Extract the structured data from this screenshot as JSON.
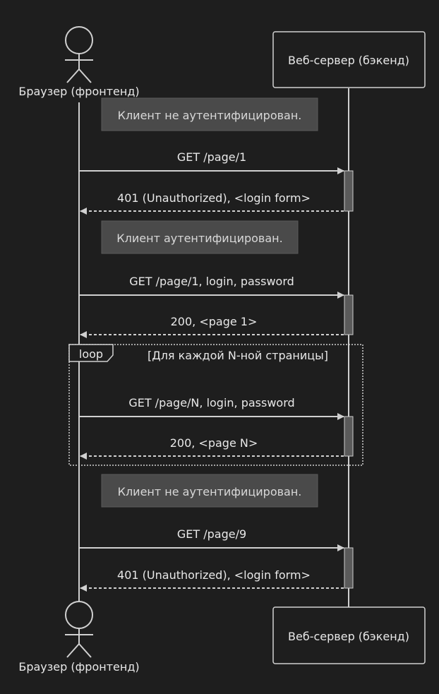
{
  "participants": {
    "browser": {
      "label": "Браузер (фронтенд)"
    },
    "server": {
      "label": "Веб-сервер (бэкенд)"
    }
  },
  "notes": [
    "Клиент не аутентифицирован.",
    "Клиент аутентифицирован.",
    "Клиент не аутентифицирован."
  ],
  "messages": [
    {
      "text": "GET /page/1",
      "dir": "request"
    },
    {
      "text": "401 (Unauthorized), <login form>",
      "dir": "response"
    },
    {
      "text": "GET /page/1, login, password",
      "dir": "request"
    },
    {
      "text": "200, <page 1>",
      "dir": "response"
    },
    {
      "text": "GET /page/N, login, password",
      "dir": "request"
    },
    {
      "text": "200, <page N>",
      "dir": "response"
    },
    {
      "text": "GET /page/9",
      "dir": "request"
    },
    {
      "text": "401 (Unauthorized), <login form>",
      "dir": "response"
    }
  ],
  "loop": {
    "keyword": "loop",
    "condition": "[Для каждой N-ной страницы]"
  },
  "colors": {
    "background": "#1e1e1e",
    "line": "#d0d0d0",
    "note_fill": "#4a4a4a",
    "activation_fill": "#5a5a5a"
  }
}
